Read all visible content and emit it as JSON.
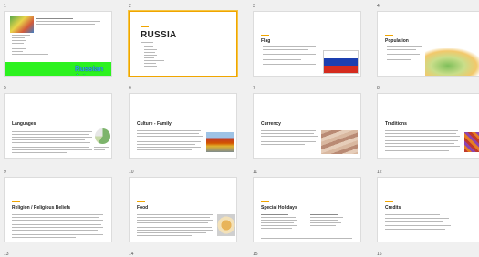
{
  "slides": [
    {
      "number": "1",
      "title": "",
      "subtitle": "Russian Art"
    },
    {
      "number": "2",
      "title": "RUSSIA"
    },
    {
      "number": "3",
      "title": "Flag"
    },
    {
      "number": "4",
      "title": "Population"
    },
    {
      "number": "5",
      "title": "Languages"
    },
    {
      "number": "6",
      "title": "Culture - Family"
    },
    {
      "number": "7",
      "title": "Currency"
    },
    {
      "number": "8",
      "title": "Traditions"
    },
    {
      "number": "9",
      "title": "Religion / Religious Beliefs"
    },
    {
      "number": "10",
      "title": "Food"
    },
    {
      "number": "11",
      "title": "Special Holidays"
    },
    {
      "number": "12",
      "title": "Credits"
    }
  ],
  "bottom_numbers": [
    "13",
    "14",
    "15",
    "16"
  ],
  "colors": {
    "accent": "#f0a500",
    "selected_border": "#f0a500",
    "flag_white": "#ffffff",
    "flag_blue": "#1c3fb0",
    "flag_red": "#d52b1e",
    "lime": "#2cf21f"
  }
}
